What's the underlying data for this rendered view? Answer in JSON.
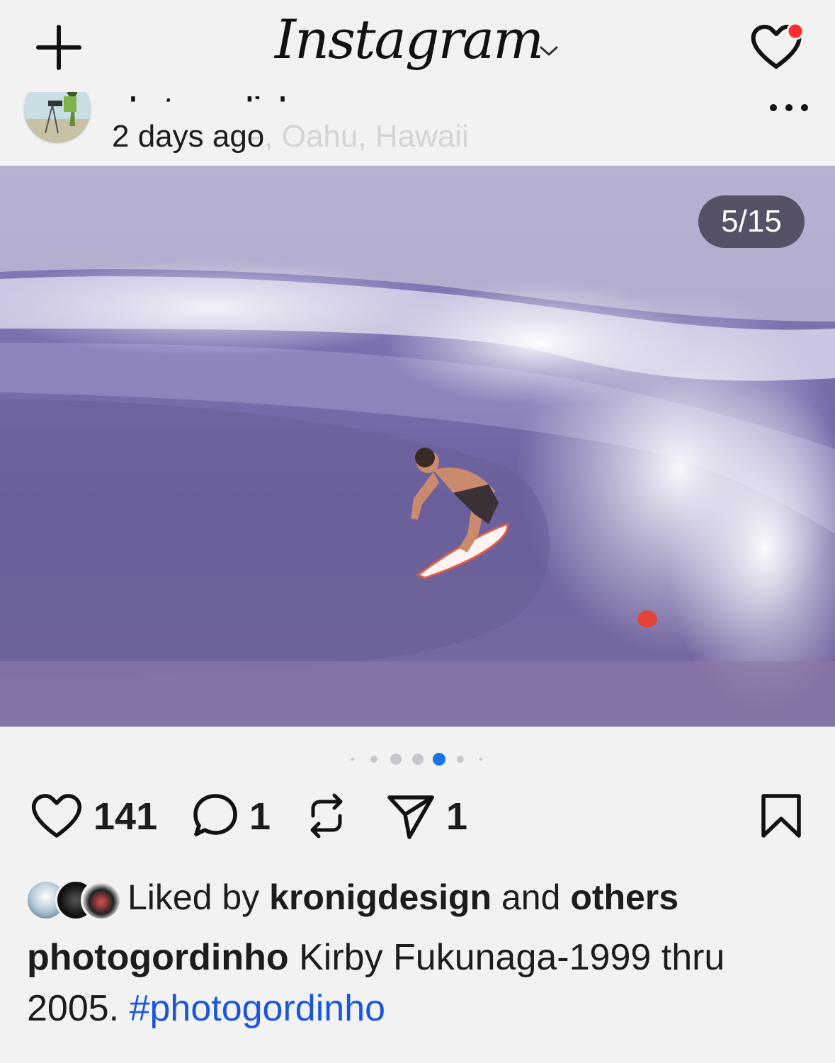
{
  "header": {
    "app_title": "Instagram",
    "new_post_icon": "plus-icon",
    "switcher_icon": "chevron-down-icon",
    "activity_icon": "heart-icon",
    "notification_dot_color": "#ff2d2d"
  },
  "post": {
    "username_partial": "photogordinho",
    "time": "2 days ago",
    "location": "North Shore, Oahu, Hawaii",
    "location_visible_suffix": "e, Oahu, Hawaii",
    "more_icon": "ellipsis-icon",
    "counter": "5/15",
    "active_dot_color": "#1a73e8",
    "likes": "141",
    "comments": "1",
    "shares": "1",
    "liked_by_prefix": "Liked by",
    "liked_by_user": "kronigdesign",
    "liked_by_and": "and",
    "liked_by_others": "others",
    "caption_user": "photogordinho",
    "caption_text": "Kirby Fukunaga-1999 thru 2005.",
    "caption_hashtag": "#photogordinho"
  }
}
